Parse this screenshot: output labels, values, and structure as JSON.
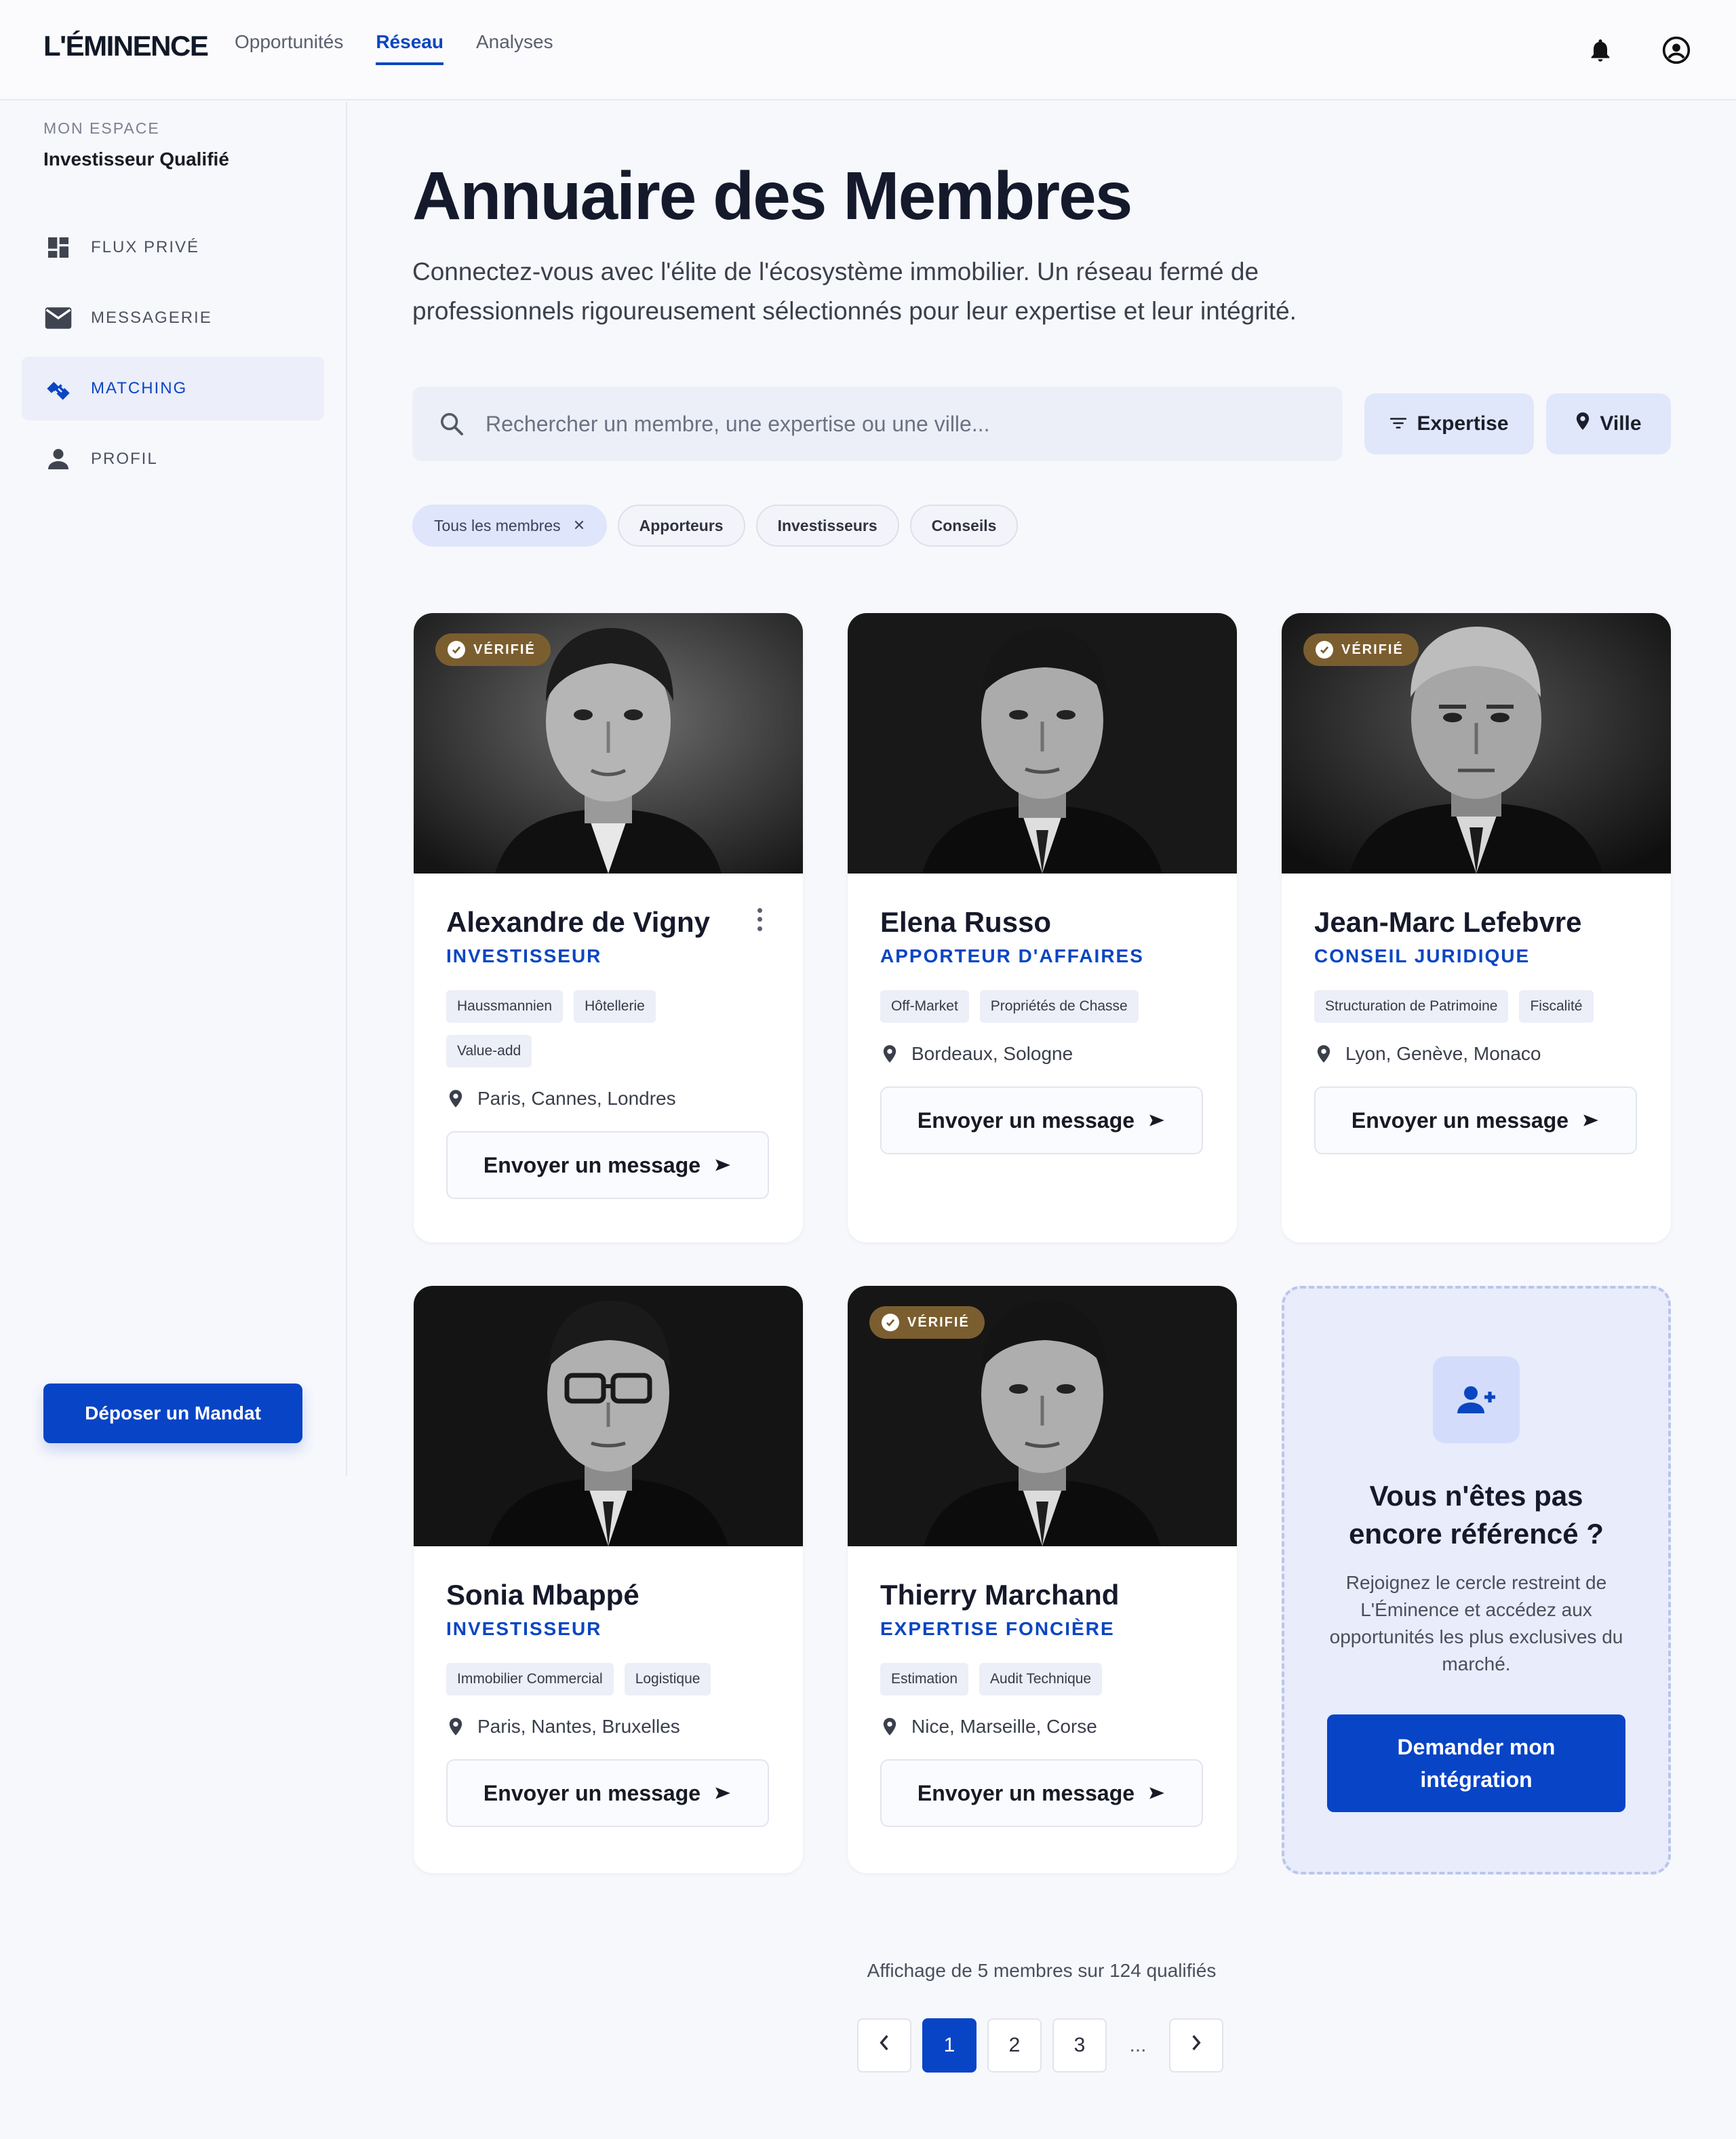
{
  "brand": "L'ÉMINENCE",
  "topnav": {
    "items": [
      {
        "label": "Opportunités",
        "active": false
      },
      {
        "label": "Réseau",
        "active": true
      },
      {
        "label": "Analyses",
        "active": false
      }
    ],
    "icons": [
      "bell-icon",
      "account-circle-icon"
    ]
  },
  "sidebar": {
    "kicker": "MON ESPACE",
    "role": "Investisseur Qualifié",
    "items": [
      {
        "label": "FLUX PRIVÉ",
        "icon": "dashboard-icon",
        "active": false
      },
      {
        "label": "MESSAGERIE",
        "icon": "mail-icon",
        "active": false
      },
      {
        "label": "MATCHING",
        "icon": "handshake-icon",
        "active": true
      },
      {
        "label": "PROFIL",
        "icon": "person-icon",
        "active": false
      }
    ],
    "cta": "Déposer un Mandat"
  },
  "page": {
    "title": "Annuaire des Membres",
    "subtitle": "Connectez-vous avec l'élite de l'écosystème immobilier. Un réseau fermé de professionnels rigoureusement sélectionnés pour leur expertise et leur intégrité."
  },
  "search": {
    "placeholder": "Rechercher un membre, une expertise ou une ville...",
    "value": ""
  },
  "filters": {
    "expertise": "Expertise",
    "city": "Ville"
  },
  "chips": [
    {
      "label": "Tous les membres",
      "active": true
    },
    {
      "label": "Apporteurs",
      "active": false
    },
    {
      "label": "Investisseurs",
      "active": false
    },
    {
      "label": "Conseils",
      "active": false
    }
  ],
  "verified_label": "VÉRIFIÉ",
  "message_label": "Envoyer un message",
  "members": [
    {
      "name": "Alexandre de Vigny",
      "role": "INVESTISSEUR",
      "verified": true,
      "tags": [
        "Haussmannien",
        "Hôtellerie",
        "Value-add"
      ],
      "location": "Paris, Cannes, Londres"
    },
    {
      "name": "Elena Russo",
      "role": "APPORTEUR D'AFFAIRES",
      "verified": false,
      "tags": [
        "Off-Market",
        "Propriétés de Chasse"
      ],
      "location": "Bordeaux, Sologne"
    },
    {
      "name": "Jean-Marc Lefebvre",
      "role": "CONSEIL JURIDIQUE",
      "verified": true,
      "tags": [
        "Structuration de Patrimoine",
        "Fiscalité"
      ],
      "location": "Lyon, Genève, Monaco"
    },
    {
      "name": "Sonia Mbappé",
      "role": "INVESTISSEUR",
      "verified": false,
      "tags": [
        "Immobilier Commercial",
        "Logistique"
      ],
      "location": "Paris, Nantes, Bruxelles"
    },
    {
      "name": "Thierry Marchand",
      "role": "EXPERTISE FONCIÈRE",
      "verified": true,
      "tags": [
        "Estimation",
        "Audit Technique"
      ],
      "location": "Nice, Marseille, Corse"
    }
  ],
  "join": {
    "title": "Vous n'êtes pas encore référencé ?",
    "text": "Rejoignez le cercle restreint de L'Éminence et accédez aux opportunités les plus exclusives du marché.",
    "cta": "Demander mon intégration"
  },
  "pagination": {
    "info": "Affichage de 5 membres sur 124 qualifiés",
    "pages": [
      "1",
      "2",
      "3",
      "..."
    ],
    "current": "1"
  },
  "colors": {
    "accent": "#0844c6",
    "badge": "#7b5e2f",
    "background": "#f7f8fc"
  }
}
